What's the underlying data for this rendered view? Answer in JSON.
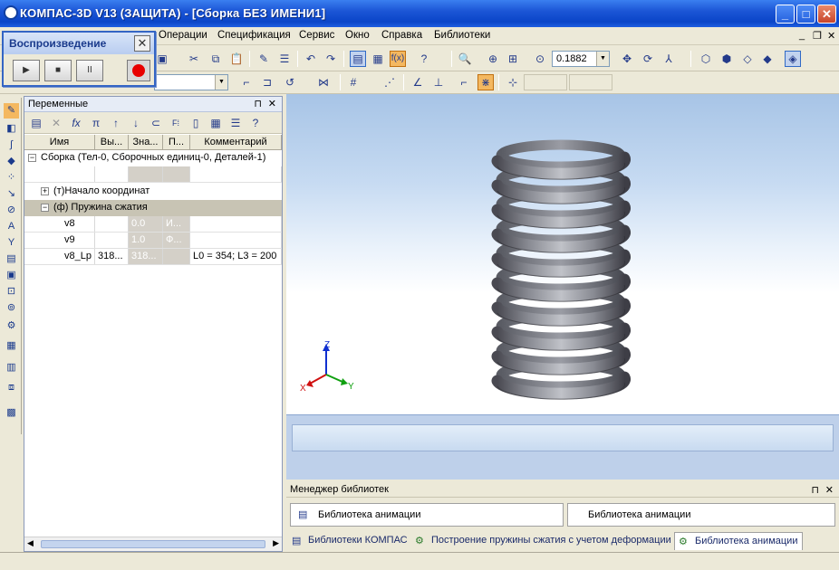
{
  "window": {
    "title": "КОМПАС-3D V13 (ЗАЩИТА) - [Сборка БЕЗ ИМЕНИ1]",
    "minimize": "_",
    "maximize": "□",
    "close": "✕"
  },
  "menu": {
    "items": [
      "Операции",
      "Спецификация",
      "Сервис",
      "Окно",
      "Справка",
      "Библиотеки"
    ],
    "mdi_controls": [
      "_",
      "❐",
      "✕"
    ]
  },
  "toolbar": {
    "zoom_value": "0.1882",
    "fx_label": "f(x)"
  },
  "playback": {
    "title": "Воспроизведение",
    "close": "✕",
    "play": "▶",
    "stop": "■",
    "pause": "II"
  },
  "variables_panel": {
    "title": "Переменные",
    "pin": "⊓",
    "close": "✕",
    "columns": [
      "Имя",
      "Вы...",
      "Зна...",
      "П...",
      "Комментарий"
    ],
    "rows": [
      {
        "name": "Сборка (Тел-0, Сборочных единиц-0, Деталей-1)",
        "expander": "−"
      },
      {
        "name": "",
        "c1": "",
        "c2": "",
        "c3": "",
        "comment": ""
      },
      {
        "name": "(т)Начало координат",
        "expander": "+"
      },
      {
        "name": "(ф) Пружина сжатия",
        "expander": "−"
      },
      {
        "name": "v8",
        "c1": "",
        "c2": "0.0",
        "c3": "И...",
        "comment": ""
      },
      {
        "name": "v9",
        "c1": "",
        "c2": "1.0",
        "c3": "Ф...",
        "comment": ""
      },
      {
        "name": "v8_Lp",
        "c1": "318...",
        "c2": "318...",
        "c3": "",
        "comment": "L0 = 354; L3 = 200"
      }
    ]
  },
  "axes": {
    "x": "X",
    "y": "Y",
    "z": "Z"
  },
  "library_manager": {
    "title": "Менеджер библиотек",
    "pin": "⊓",
    "close": "✕",
    "boxes": [
      "Библиотека анимации",
      "Библиотека анимации"
    ],
    "tabs": [
      "Библиотеки КОМПАС",
      "Построение пружины сжатия с учетом деформации",
      "Библиотека анимации"
    ],
    "active_tab": 2
  },
  "colors": {
    "title_bar": "#0a45c8",
    "accent": "#316ac5",
    "record": "#e80000",
    "highlight": "#f4b860",
    "axis_x": "#d01010",
    "axis_y": "#10a010",
    "axis_z": "#1030d0"
  }
}
